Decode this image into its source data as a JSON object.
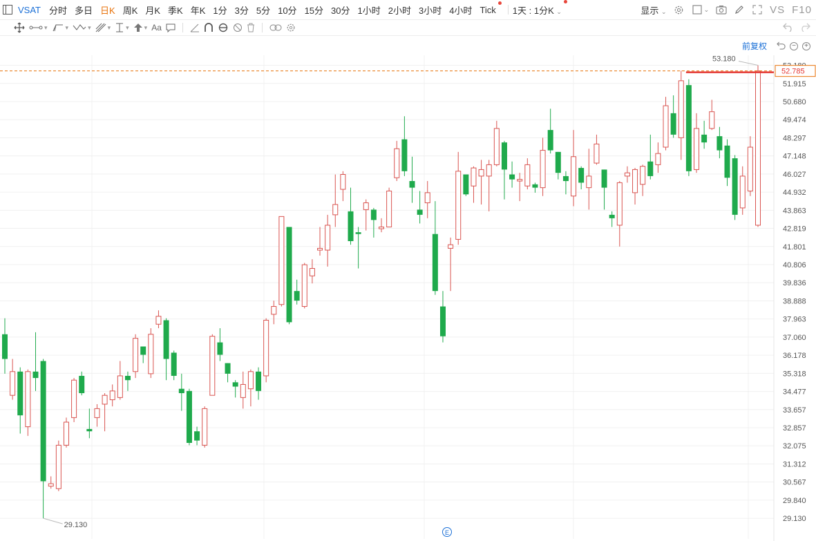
{
  "toolbar": {
    "symbol": "VSAT",
    "periods": [
      "分时",
      "多日",
      "日K",
      "周K",
      "月K",
      "季K",
      "年K",
      "1分",
      "3分",
      "5分",
      "10分",
      "15分",
      "30分",
      "1小时",
      "2小时",
      "3小时",
      "4小时"
    ],
    "active_period": "日K",
    "tick_label": "Tick",
    "kline_select": "1天 : 1分K",
    "display_label": "显示",
    "vs_label": "VS",
    "f10_label": "F10"
  },
  "adjust_label": "前复权",
  "bottom_marker": "E",
  "colors": {
    "up": "#d9534f",
    "down": "#1faa4c",
    "current_price_line": "#e8730c",
    "high_line": "#e53935",
    "toolbar_active": "#e8730c",
    "symbol": "#1a6fd6"
  },
  "chart_data": {
    "type": "candlestick",
    "symbol": "VSAT",
    "period": "日K",
    "y_ticks": [
      53.18,
      51.915,
      50.68,
      49.474,
      48.297,
      47.148,
      46.027,
      44.932,
      43.863,
      42.819,
      41.801,
      40.806,
      39.836,
      38.888,
      37.963,
      37.06,
      36.178,
      35.318,
      34.477,
      33.657,
      32.857,
      32.075,
      31.312,
      30.567,
      29.84,
      29.13
    ],
    "log_scale": true,
    "ylim": [
      29.0,
      53.5
    ],
    "current_price": 52.785,
    "annotations": {
      "max": 53.18,
      "min": 29.13
    },
    "candles": [
      {
        "o": 37.2,
        "c": 36.0,
        "h": 38.0,
        "l": 35.3
      },
      {
        "o": 34.3,
        "c": 35.4,
        "h": 36.0,
        "l": 34.1
      },
      {
        "o": 35.4,
        "c": 33.4,
        "h": 35.6,
        "l": 32.6
      },
      {
        "o": 32.9,
        "c": 35.4,
        "h": 35.5,
        "l": 32.5
      },
      {
        "o": 35.4,
        "c": 35.1,
        "h": 37.3,
        "l": 34.5
      },
      {
        "o": 35.9,
        "c": 30.6,
        "h": 36.0,
        "l": 29.13
      },
      {
        "o": 30.4,
        "c": 30.5,
        "h": 30.8,
        "l": 30.3
      },
      {
        "o": 30.3,
        "c": 32.1,
        "h": 32.3,
        "l": 30.2
      },
      {
        "o": 32.1,
        "c": 33.1,
        "h": 33.3,
        "l": 32.0
      },
      {
        "o": 33.3,
        "c": 35.0,
        "h": 35.1,
        "l": 33.1
      },
      {
        "o": 35.2,
        "c": 34.4,
        "h": 35.4,
        "l": 34.3
      },
      {
        "o": 32.8,
        "c": 32.7,
        "h": 33.7,
        "l": 32.4
      },
      {
        "o": 33.3,
        "c": 33.7,
        "h": 33.9,
        "l": 32.9
      },
      {
        "o": 33.9,
        "c": 34.3,
        "h": 34.4,
        "l": 32.7
      },
      {
        "o": 34.1,
        "c": 34.5,
        "h": 34.8,
        "l": 33.8
      },
      {
        "o": 34.2,
        "c": 35.2,
        "h": 35.9,
        "l": 34.1
      },
      {
        "o": 35.2,
        "c": 35.0,
        "h": 35.4,
        "l": 34.5
      },
      {
        "o": 35.4,
        "c": 37.0,
        "h": 37.2,
        "l": 35.1
      },
      {
        "o": 36.6,
        "c": 36.2,
        "h": 36.6,
        "l": 35.8
      },
      {
        "o": 35.3,
        "c": 37.2,
        "h": 37.5,
        "l": 35.1
      },
      {
        "o": 37.7,
        "c": 38.1,
        "h": 38.4,
        "l": 37.5
      },
      {
        "o": 37.9,
        "c": 36.0,
        "h": 38.0,
        "l": 35.0
      },
      {
        "o": 36.3,
        "c": 35.2,
        "h": 36.4,
        "l": 35.0
      },
      {
        "o": 34.6,
        "c": 34.4,
        "h": 35.3,
        "l": 33.6
      },
      {
        "o": 34.5,
        "c": 32.2,
        "h": 34.6,
        "l": 32.1
      },
      {
        "o": 32.7,
        "c": 32.3,
        "h": 32.9,
        "l": 32.1
      },
      {
        "o": 32.1,
        "c": 33.7,
        "h": 33.8,
        "l": 32.0
      },
      {
        "o": 34.3,
        "c": 37.1,
        "h": 37.2,
        "l": 34.3
      },
      {
        "o": 36.8,
        "c": 36.2,
        "h": 37.5,
        "l": 35.9
      },
      {
        "o": 35.8,
        "c": 35.3,
        "h": 35.8,
        "l": 34.9
      },
      {
        "o": 34.9,
        "c": 34.7,
        "h": 35.0,
        "l": 34.2
      },
      {
        "o": 34.2,
        "c": 34.8,
        "h": 35.4,
        "l": 33.7
      },
      {
        "o": 34.6,
        "c": 35.4,
        "h": 35.5,
        "l": 33.8
      },
      {
        "o": 35.4,
        "c": 34.5,
        "h": 35.6,
        "l": 34.1
      },
      {
        "o": 35.2,
        "c": 37.9,
        "h": 38.0,
        "l": 34.9
      },
      {
        "o": 38.2,
        "c": 38.6,
        "h": 38.9,
        "l": 37.7
      },
      {
        "o": 38.7,
        "c": 43.5,
        "h": 43.5,
        "l": 38.6
      },
      {
        "o": 42.9,
        "c": 37.8,
        "h": 42.9,
        "l": 37.7
      },
      {
        "o": 39.4,
        "c": 38.9,
        "h": 40.0,
        "l": 38.7
      },
      {
        "o": 38.6,
        "c": 40.8,
        "h": 40.9,
        "l": 38.5
      },
      {
        "o": 40.2,
        "c": 40.6,
        "h": 41.1,
        "l": 39.8
      },
      {
        "o": 41.6,
        "c": 41.7,
        "h": 42.9,
        "l": 41.3
      },
      {
        "o": 41.6,
        "c": 43.0,
        "h": 43.6,
        "l": 40.7
      },
      {
        "o": 43.6,
        "c": 44.2,
        "h": 46.0,
        "l": 42.9
      },
      {
        "o": 45.1,
        "c": 46.0,
        "h": 46.2,
        "l": 44.4
      },
      {
        "o": 43.8,
        "c": 42.1,
        "h": 45.2,
        "l": 41.9
      },
      {
        "o": 42.6,
        "c": 42.5,
        "h": 42.9,
        "l": 40.6
      },
      {
        "o": 43.9,
        "c": 44.3,
        "h": 44.5,
        "l": 42.7
      },
      {
        "o": 43.9,
        "c": 43.3,
        "h": 44.0,
        "l": 42.3
      },
      {
        "o": 42.8,
        "c": 42.9,
        "h": 43.4,
        "l": 42.6
      },
      {
        "o": 42.9,
        "c": 45.0,
        "h": 45.2,
        "l": 42.9
      },
      {
        "o": 45.8,
        "c": 47.6,
        "h": 48.1,
        "l": 45.6
      },
      {
        "o": 48.2,
        "c": 46.2,
        "h": 49.7,
        "l": 45.9
      },
      {
        "o": 45.6,
        "c": 45.2,
        "h": 47.1,
        "l": 44.3
      },
      {
        "o": 43.9,
        "c": 43.6,
        "h": 45.0,
        "l": 43.1
      },
      {
        "o": 44.3,
        "c": 44.9,
        "h": 45.6,
        "l": 43.4
      },
      {
        "o": 42.5,
        "c": 39.4,
        "h": 44.4,
        "l": 39.2
      },
      {
        "o": 38.6,
        "c": 37.1,
        "h": 39.4,
        "l": 36.8
      },
      {
        "o": 41.7,
        "c": 41.9,
        "h": 42.3,
        "l": 39.4
      },
      {
        "o": 42.2,
        "c": 46.2,
        "h": 47.4,
        "l": 41.9
      },
      {
        "o": 46.0,
        "c": 44.8,
        "h": 46.0,
        "l": 44.7
      },
      {
        "o": 45.3,
        "c": 46.4,
        "h": 46.5,
        "l": 44.3
      },
      {
        "o": 45.9,
        "c": 46.3,
        "h": 46.9,
        "l": 44.2
      },
      {
        "o": 45.9,
        "c": 46.6,
        "h": 46.9,
        "l": 43.8
      },
      {
        "o": 46.6,
        "c": 48.9,
        "h": 49.4,
        "l": 46.5
      },
      {
        "o": 48.0,
        "c": 46.3,
        "h": 48.1,
        "l": 44.5
      },
      {
        "o": 46.0,
        "c": 45.7,
        "h": 46.8,
        "l": 45.2
      },
      {
        "o": 45.6,
        "c": 45.7,
        "h": 46.1,
        "l": 44.4
      },
      {
        "o": 45.3,
        "c": 46.6,
        "h": 47.0,
        "l": 45.1
      },
      {
        "o": 45.4,
        "c": 45.2,
        "h": 45.5,
        "l": 44.9
      },
      {
        "o": 45.2,
        "c": 47.5,
        "h": 48.3,
        "l": 44.7
      },
      {
        "o": 48.8,
        "c": 47.5,
        "h": 50.2,
        "l": 47.3
      },
      {
        "o": 47.4,
        "c": 46.1,
        "h": 47.4,
        "l": 45.7
      },
      {
        "o": 45.9,
        "c": 45.6,
        "h": 46.2,
        "l": 44.8
      },
      {
        "o": 44.7,
        "c": 47.1,
        "h": 48.8,
        "l": 44.1
      },
      {
        "o": 46.4,
        "c": 45.5,
        "h": 46.5,
        "l": 45.1
      },
      {
        "o": 45.2,
        "c": 45.9,
        "h": 47.6,
        "l": 43.9
      },
      {
        "o": 46.7,
        "c": 47.9,
        "h": 48.5,
        "l": 46.6
      },
      {
        "o": 46.3,
        "c": 45.2,
        "h": 46.3,
        "l": 43.9
      },
      {
        "o": 43.6,
        "c": 43.4,
        "h": 43.8,
        "l": 42.9
      },
      {
        "o": 43.0,
        "c": 45.5,
        "h": 45.6,
        "l": 41.8
      },
      {
        "o": 45.9,
        "c": 46.1,
        "h": 46.5,
        "l": 45.5
      },
      {
        "o": 44.9,
        "c": 46.3,
        "h": 46.4,
        "l": 44.2
      },
      {
        "o": 45.4,
        "c": 46.5,
        "h": 46.6,
        "l": 44.7
      },
      {
        "o": 46.8,
        "c": 45.9,
        "h": 48.5,
        "l": 45.7
      },
      {
        "o": 46.6,
        "c": 47.3,
        "h": 48.0,
        "l": 46.1
      },
      {
        "o": 47.7,
        "c": 50.4,
        "h": 51.0,
        "l": 47.5
      },
      {
        "o": 49.9,
        "c": 48.5,
        "h": 51.1,
        "l": 48.3
      },
      {
        "o": 48.3,
        "c": 52.1,
        "h": 52.8,
        "l": 46.9
      },
      {
        "o": 51.8,
        "c": 46.2,
        "h": 52.2,
        "l": 45.9
      },
      {
        "o": 46.3,
        "c": 48.9,
        "h": 49.9,
        "l": 46.1
      },
      {
        "o": 48.5,
        "c": 48.0,
        "h": 49.4,
        "l": 47.6
      },
      {
        "o": 48.9,
        "c": 50.0,
        "h": 50.8,
        "l": 48.8
      },
      {
        "o": 48.4,
        "c": 47.5,
        "h": 49.0,
        "l": 47.0
      },
      {
        "o": 47.8,
        "c": 45.8,
        "h": 48.2,
        "l": 45.3
      },
      {
        "o": 47.0,
        "c": 43.6,
        "h": 47.2,
        "l": 43.3
      },
      {
        "o": 44.0,
        "c": 45.9,
        "h": 46.5,
        "l": 43.6
      },
      {
        "o": 45.0,
        "c": 47.7,
        "h": 48.4,
        "l": 44.7
      },
      {
        "o": 43.0,
        "c": 52.785,
        "h": 53.18,
        "l": 42.9
      }
    ]
  }
}
